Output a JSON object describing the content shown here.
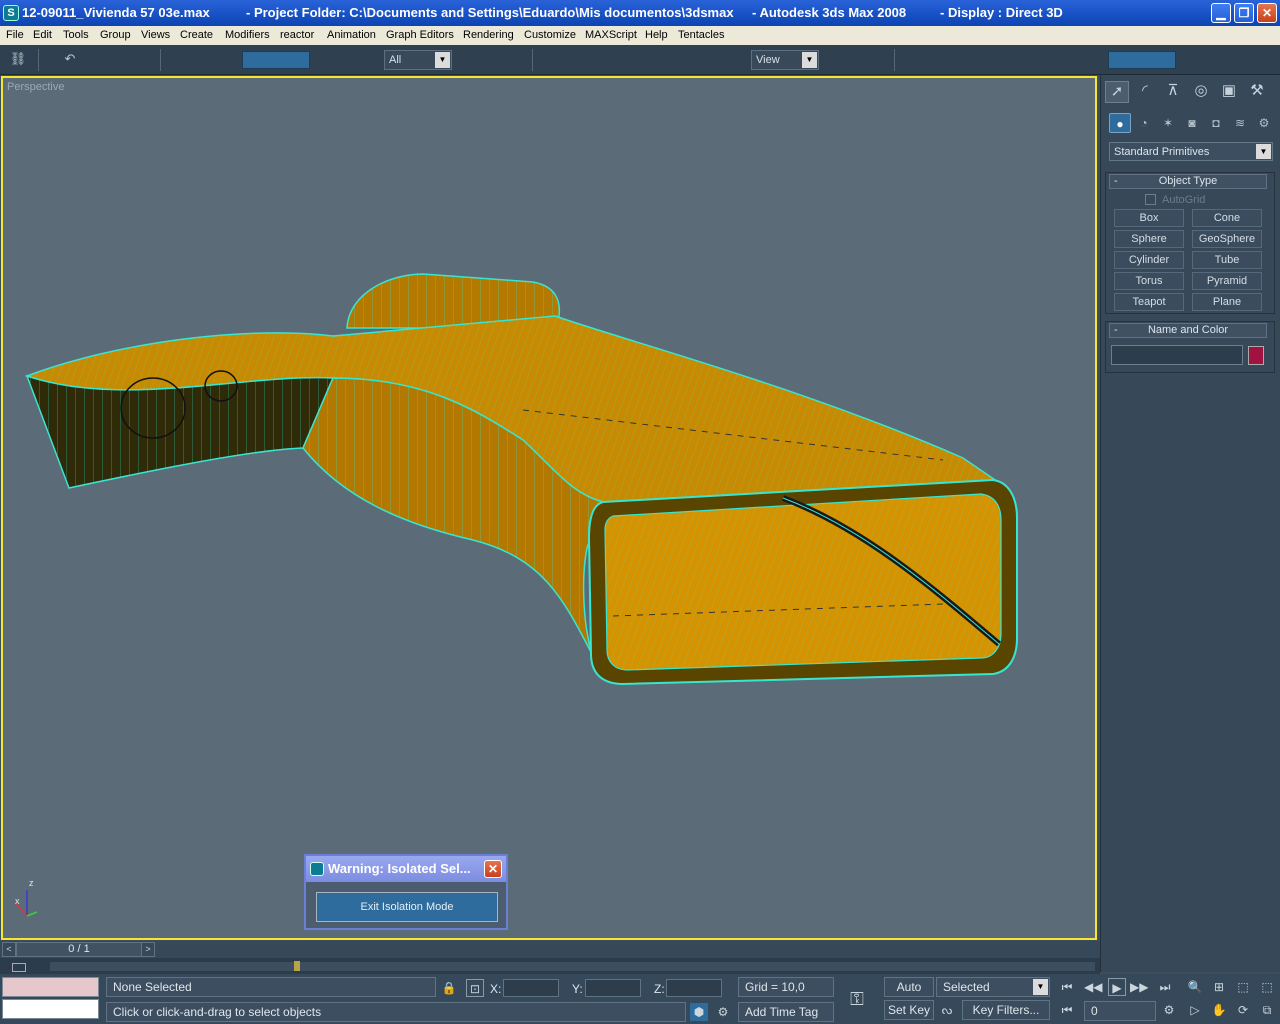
{
  "titlebar": {
    "file": "12-09011_Vivienda 57 03e.max",
    "project": "- Project Folder: C:\\Documents and Settings\\Eduardo\\Mis documentos\\3dsmax",
    "app": "- Autodesk 3ds Max 2008",
    "display": "- Display : Direct 3D"
  },
  "menu": [
    "File",
    "Edit",
    "Tools",
    "Group",
    "Views",
    "Create",
    "Modifiers",
    "reactor",
    "Animation",
    "Graph Editors",
    "Rendering",
    "Customize",
    "MAXScript",
    "Help",
    "Tentacles"
  ],
  "toolbar": {
    "selection_filter": "All",
    "reference_coord": "View"
  },
  "viewport": {
    "label": "Perspective",
    "axis_z": "z",
    "axis_x": "x",
    "colors": {
      "background": "#5b6b78",
      "border": "#f5e632",
      "object": "#c88a00",
      "wire": "#37e6d2"
    }
  },
  "warning_dialog": {
    "title": "Warning: Isolated Sel...",
    "button": "Exit Isolation Mode"
  },
  "command_panel": {
    "category": "Standard Primitives",
    "object_type_title": "Object Type",
    "autogrid": "AutoGrid",
    "buttons": [
      "Box",
      "Cone",
      "Sphere",
      "GeoSphere",
      "Cylinder",
      "Tube",
      "Torus",
      "Pyramid",
      "Teapot",
      "Plane"
    ],
    "name_color_title": "Name and Color",
    "swatch_color": "#a0123f"
  },
  "timeline": {
    "frame": "0 / 1",
    "prev": "<",
    "next": ">"
  },
  "status": {
    "selection": "None Selected",
    "prompt": "Click or click-and-drag to select objects",
    "x_label": "X:",
    "y_label": "Y:",
    "z_label": "Z:",
    "grid": "Grid = 10,0",
    "add_time_tag": "Add Time Tag",
    "auto_key": "Auto Key",
    "set_key": "Set Key",
    "key_mode": "Selected",
    "key_filters": "Key Filters...",
    "frame_field": "0"
  }
}
